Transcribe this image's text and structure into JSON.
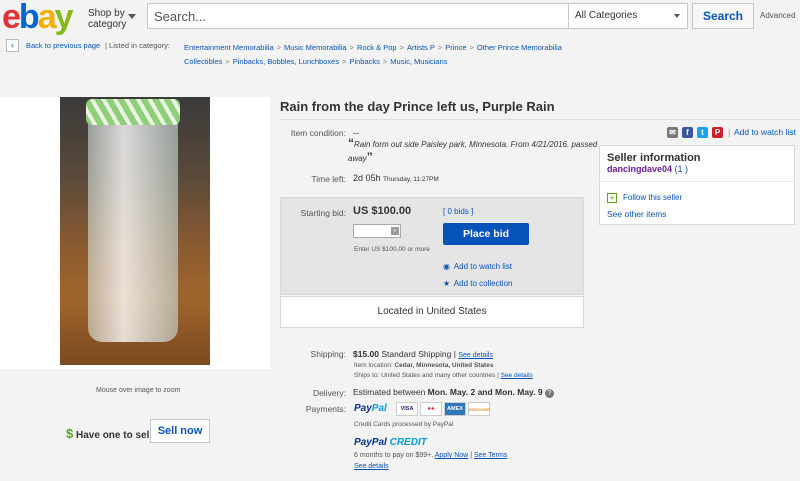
{
  "header": {
    "logo_letters": [
      "e",
      "b",
      "a",
      "y"
    ],
    "shop_by_category": [
      "Shop by",
      "category"
    ],
    "search_placeholder": "Search...",
    "category_select": "All Categories",
    "search_button": "Search",
    "advanced": "Advanced"
  },
  "breadcrumb": {
    "back_icon": "‹",
    "back_link": "Back to previous page",
    "listed_in": "| Listed in category:",
    "items": [
      "Entertainment Memorabilia",
      "Music Memorabilia",
      "Rock & Pop",
      "Artists P",
      "Prince",
      "Other Prince Memorabilia",
      "Collectibles",
      "Pinbacks, Bobbles, Lunchboxes",
      "Pinbacks",
      "Music, Musicians"
    ],
    "separator": ">"
  },
  "image_panel": {
    "zoom_hint": "Mouse over image to zoom",
    "have_one_symbol": "$",
    "have_one": "Have one to sell?",
    "sell_now": "Sell now"
  },
  "item": {
    "title": "Rain from the day Prince left us, Purple Rain",
    "condition_label": "Item condition:",
    "condition_value": "--",
    "quote_open": "“",
    "quote_text": "Rain form out side Paisley park, Minnesota. From 4/21/2016. passed away",
    "quote_close": "”",
    "time_left_label": "Time left:",
    "time_left_value": "2d 05h",
    "time_left_detail": "Thursday, 11:27PM"
  },
  "share": {
    "icons": [
      {
        "name": "email-icon",
        "glyph": "✉",
        "color": "#777777"
      },
      {
        "name": "facebook-icon",
        "glyph": "f",
        "color": "#3b5998"
      },
      {
        "name": "twitter-icon",
        "glyph": "t",
        "color": "#1da1f2"
      },
      {
        "name": "pinterest-icon",
        "glyph": "P",
        "color": "#cb2027"
      }
    ],
    "separator": "|",
    "watch_link": "Add to watch list"
  },
  "bid": {
    "starting_label": "Starting bid:",
    "price": "US $100.00",
    "bids": "[ 0 bids ]",
    "input_value": "",
    "input_icon": "≡",
    "place_bid": "Place bid",
    "enter_note": "Enter US $100.00 or more",
    "watch_icon": "◉",
    "watch": "Add to watch list",
    "collection_icon": "★",
    "collection": "Add to collection",
    "location": "Located in United States"
  },
  "seller": {
    "title": "Seller information",
    "username": "dancingdave04",
    "feedback": "(1 )",
    "follow_icon": "+",
    "follow": "Follow this seller",
    "other_items": "See other items"
  },
  "shipping": {
    "label": "Shipping:",
    "cost": "$15.00",
    "method": "Standard Shipping",
    "separator": "|",
    "see_details": "See details",
    "item_location": "Item location:",
    "item_location_value": "Cedar, Minnesota, United States",
    "ships_to": "Ships to: United States and many other countries",
    "ships_to_separator": "|",
    "ships_see_details": "See details",
    "delivery_label": "Delivery:",
    "delivery_value": "Estimated between",
    "delivery_dates": "Mon. May. 2 and Mon. May. 9",
    "delivery_help": "?",
    "payments_label": "Payments:",
    "paypal_a": "Pay",
    "paypal_b": "Pal",
    "cards": [
      {
        "name": "visa-icon",
        "label": "VISA",
        "color": "#1a1f71"
      },
      {
        "name": "mastercard-icon",
        "label": "●●",
        "color": "#eb001b"
      },
      {
        "name": "amex-icon",
        "label": "AMEX",
        "color": "#2e77bb"
      },
      {
        "name": "discover-icon",
        "label": "DISCOVER",
        "color": "#f58220"
      }
    ],
    "cc_note": "Credit Cards processed by PayPal",
    "credit_a": "PayPal",
    "credit_b": "CREDIT",
    "credit_line": "6 months to pay on $99+.",
    "apply_now": "Apply Now",
    "credit_separator": "|",
    "see_terms": "See Terms",
    "credit_details": "See details"
  }
}
